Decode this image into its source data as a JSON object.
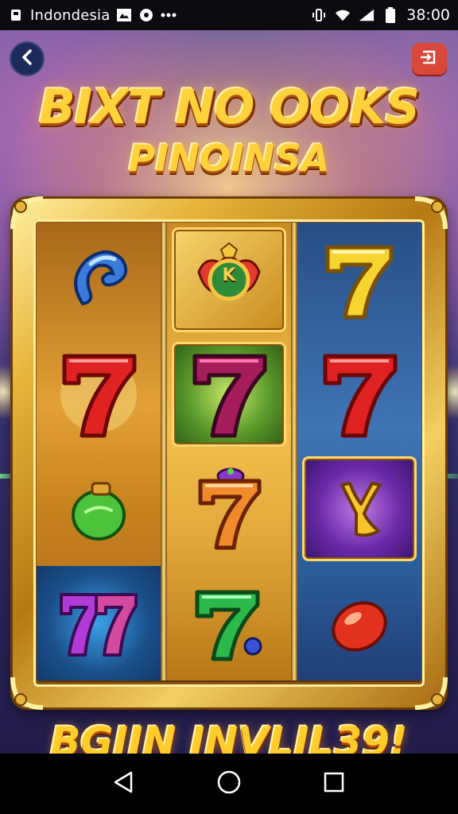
{
  "status_bar": {
    "carrier": "Indondesia",
    "time": "38:00",
    "icons": [
      "notification-icon",
      "image-icon",
      "chat-icon",
      "more-icon",
      "vibrate-icon",
      "wifi-icon",
      "signal-icon",
      "battery-icon"
    ]
  },
  "header": {
    "back_icon": "chevron-left-icon",
    "exit_icon": "exit-icon"
  },
  "title": {
    "line1": "BIXT NO OOKS",
    "line2": "PINOINSA"
  },
  "reels": [
    {
      "symbols": [
        "blue-swirl-gem",
        "red-seven",
        "green-leaf-gem",
        "purple-seven"
      ]
    },
    {
      "symbols": [
        "crown-k-emblem",
        "purple-seven",
        "orange-seven",
        "green-seven"
      ]
    },
    {
      "symbols": [
        "yellow-seven",
        "red-seven",
        "slingshot-emblem",
        "red-oval-gem"
      ]
    }
  ],
  "reel_texts": {
    "k_emblem": "K"
  },
  "bottom": {
    "banner": "BGIIN INVLIL39!"
  },
  "nav": {
    "back_icon": "triangle-back-icon",
    "home_icon": "circle-home-icon",
    "recents_icon": "square-recents-icon"
  },
  "colors": {
    "title_gold": "#ffd23c",
    "frame_gold": "#e7b43a",
    "exit_red": "#d9473a",
    "back_navy": "#1d2a5c"
  }
}
